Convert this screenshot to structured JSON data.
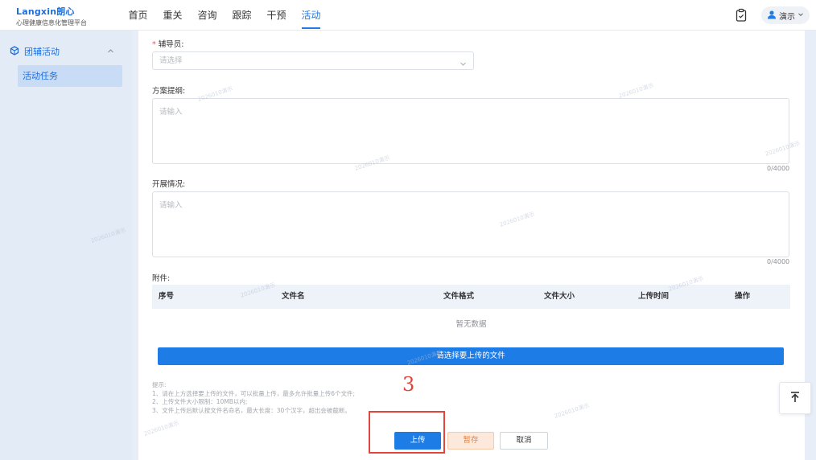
{
  "header": {
    "brand": "Langxin朗心",
    "subtitle": "心理健康信息化管理平台",
    "nav": [
      "首页",
      "重关",
      "咨询",
      "跟踪",
      "干预",
      "活动"
    ],
    "active_nav": "活动",
    "user_label": "演示",
    "accent": "#1e7ce6"
  },
  "sidebar": {
    "group_label": "团辅活动",
    "items": [
      {
        "label": "活动任务",
        "active": true
      }
    ]
  },
  "form": {
    "counselor": {
      "label": "辅导员:",
      "required": true,
      "placeholder": "请选择"
    },
    "outline": {
      "label": "方案提纲:",
      "placeholder": "请输入",
      "counter": "0/4000"
    },
    "situation": {
      "label": "开展情况:",
      "placeholder": "请输入",
      "counter": "0/4000"
    },
    "attachments": {
      "label": "附件:",
      "columns": [
        "序号",
        "文件名",
        "文件格式",
        "文件大小",
        "上传时间",
        "操作"
      ],
      "empty_text": "暂无数据",
      "upload_bar_label": "请选择要上传的文件"
    },
    "tips": [
      "提示:",
      "1、请在上方选择要上传的文件，可以批量上传，最多允许批量上传6个文件;",
      "2、上传文件大小限制：10MB以内;",
      "3、文件上传后默认按文件名命名，最大长度：30个汉字，超出会被截断。"
    ]
  },
  "actions": {
    "upload": "上传",
    "save_draft": "暂存",
    "cancel": "取消"
  },
  "annotation": {
    "text": "3",
    "color": "#e2453a"
  },
  "watermark": "2026010演示"
}
